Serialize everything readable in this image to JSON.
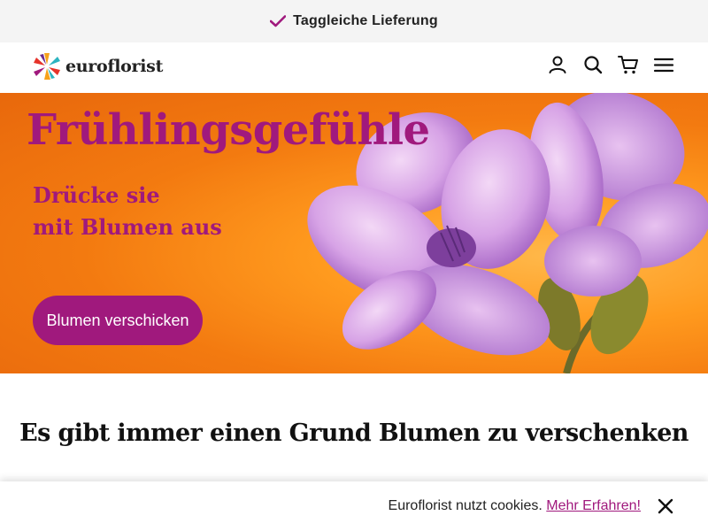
{
  "topbar": {
    "label": "Taggleiche Lieferung",
    "icon": "check-icon",
    "icon_color": "#a0197d"
  },
  "header": {
    "logo_text": "euroflorist",
    "icons": [
      "user-icon",
      "search-icon",
      "cart-icon",
      "menu-icon"
    ]
  },
  "hero": {
    "title": "Frühlingsgefühle",
    "subtitle_line1": "Drücke sie",
    "subtitle_line2": "mit Blumen aus",
    "cta_label": "Blumen verschicken",
    "accent_color": "#a0197d",
    "background_color": "#f37a10"
  },
  "section": {
    "title": "Es gibt immer einen Grund Blumen zu verschenken"
  },
  "cookie": {
    "text": "Euroflorist nutzt cookies.",
    "link_label": "Mehr Erfahren!",
    "close_icon": "close-icon"
  }
}
